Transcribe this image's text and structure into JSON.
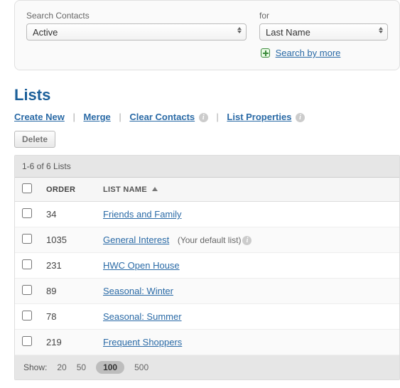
{
  "search": {
    "label_left": "Search Contacts",
    "label_right": "for",
    "status_value": "Active",
    "field_value": "Last Name",
    "more_label": "Search by more"
  },
  "section": {
    "title": "Lists"
  },
  "actions": {
    "create": "Create New",
    "merge": "Merge",
    "clear": "Clear Contacts",
    "props": "List Properties",
    "delete": "Delete"
  },
  "table": {
    "summary": "1-6 of 6 Lists",
    "col_order": "ORDER",
    "col_name": "LIST NAME",
    "rows": [
      {
        "order": "34",
        "name": "Friends and Family",
        "note": ""
      },
      {
        "order": "1035",
        "name": "General Interest",
        "note": "(Your default list)"
      },
      {
        "order": "231",
        "name": "HWC Open House",
        "note": ""
      },
      {
        "order": "89",
        "name": "Seasonal: Winter",
        "note": ""
      },
      {
        "order": "78",
        "name": "Seasonal: Summer",
        "note": ""
      },
      {
        "order": "219",
        "name": "Frequent Shoppers",
        "note": ""
      }
    ]
  },
  "pager": {
    "label": "Show:",
    "options": [
      "20",
      "50",
      "100",
      "500"
    ],
    "active": "100"
  }
}
